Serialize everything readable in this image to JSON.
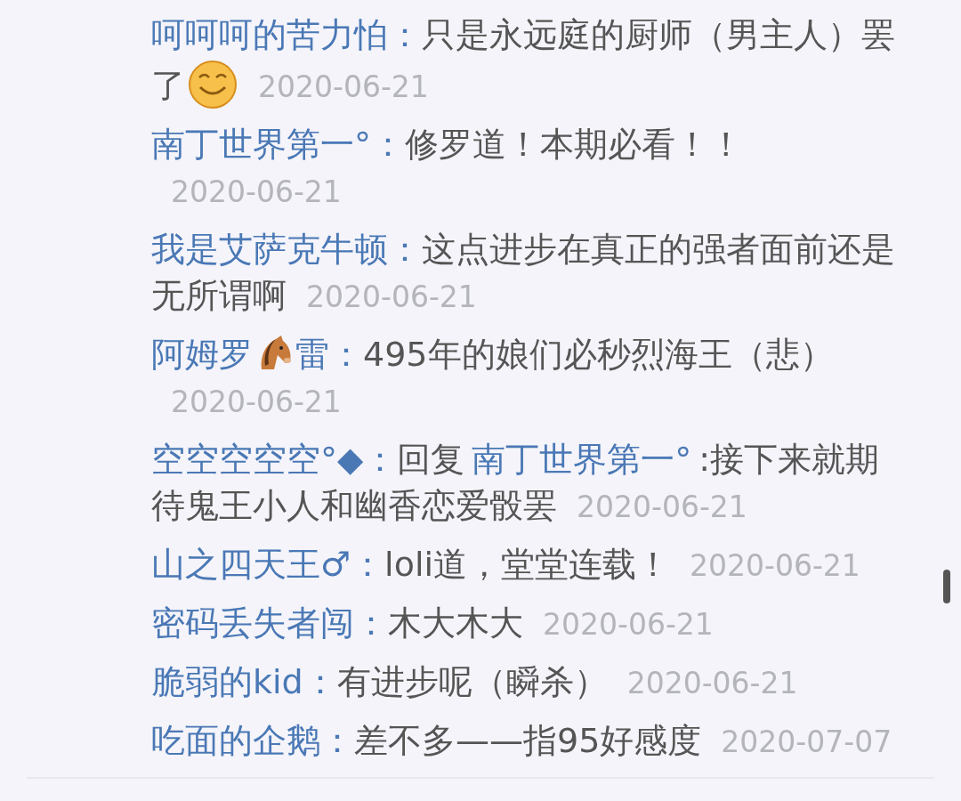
{
  "comments": [
    {
      "segments": [
        {
          "kind": "user",
          "text": "呵呵呵的苦力怕："
        },
        {
          "kind": "text",
          "text": "只是永远庭的厨师（男主人）罢了"
        },
        {
          "kind": "smiley"
        }
      ],
      "date": "2020-06-21"
    },
    {
      "segments": [
        {
          "kind": "user",
          "text": "南丁世界第一°："
        },
        {
          "kind": "text",
          "text": "修罗道！本期必看！！"
        }
      ],
      "date": "2020-06-21"
    },
    {
      "segments": [
        {
          "kind": "user",
          "text": "我是艾萨克牛顿："
        },
        {
          "kind": "text",
          "text": "这点进步在真正的强者面前还是无所谓啊"
        }
      ],
      "date": "2020-06-21"
    },
    {
      "segments": [
        {
          "kind": "user",
          "text": "阿姆罗"
        },
        {
          "kind": "horse"
        },
        {
          "kind": "user",
          "text": "雷："
        },
        {
          "kind": "text",
          "text": "495年的娘们必秒烈海王（悲）"
        }
      ],
      "date": "2020-06-21"
    },
    {
      "segments": [
        {
          "kind": "user",
          "text": "空空空空空°◆："
        },
        {
          "kind": "text",
          "text": "回复"
        },
        {
          "kind": "reply_user",
          "text": "南丁世界第一°"
        },
        {
          "kind": "text",
          "text": ":接下来就期待鬼王小人和幽香恋爱骰罢"
        }
      ],
      "date": "2020-06-21"
    },
    {
      "segments": [
        {
          "kind": "user",
          "text": "山之四天王♂："
        },
        {
          "kind": "text",
          "text": "loli道，堂堂连载！"
        }
      ],
      "date": "2020-06-21"
    },
    {
      "segments": [
        {
          "kind": "user",
          "text": "密码丢失者闯："
        },
        {
          "kind": "text",
          "text": "木大木大"
        }
      ],
      "date": "2020-06-21"
    },
    {
      "segments": [
        {
          "kind": "user",
          "text": "脆弱的kid："
        },
        {
          "kind": "text",
          "text": "有进步呢（瞬杀）"
        }
      ],
      "date": "2020-06-21"
    },
    {
      "segments": [
        {
          "kind": "user",
          "text": "吃面的企鹅："
        },
        {
          "kind": "text",
          "text": "差不多——指95好感度"
        }
      ],
      "date": "2020-07-07"
    }
  ]
}
